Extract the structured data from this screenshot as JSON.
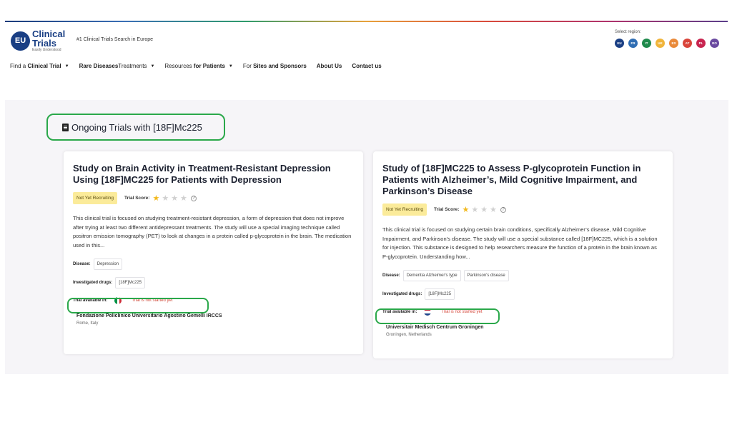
{
  "header": {
    "logo": {
      "badge": "EU",
      "line1": "Clinical",
      "line2": "Trials",
      "line3": "Easily Understood"
    },
    "tagline": "#1 Clinical Trials Search in Europe",
    "region_label": "Select region:",
    "regions": [
      {
        "code": "EU",
        "color": "#1a3f84"
      },
      {
        "code": "FR",
        "color": "#2f6db3"
      },
      {
        "code": "IT",
        "color": "#1f8a4c"
      },
      {
        "code": "UK",
        "color": "#f0b43a"
      },
      {
        "code": "ES",
        "color": "#e98a3a"
      },
      {
        "code": "AT",
        "color": "#d9443a"
      },
      {
        "code": "PL",
        "color": "#c8244f"
      },
      {
        "code": "RO",
        "color": "#6a4aa0"
      }
    ]
  },
  "nav": {
    "find_prefix": "Find a ",
    "find_bold": "Clinical Trial",
    "rare_bold": "Rare Diseases",
    "rare_suffix": " Treatments",
    "resources_prefix": "Resources ",
    "resources_bold": "for Patients",
    "sites_prefix": "For ",
    "sites_bold": "Sites and Sponsors",
    "about": "About Us",
    "contact": "Contact us"
  },
  "section": {
    "title": "Ongoing Trials with [18F]Mc225"
  },
  "trials": [
    {
      "title": "Study on Brain Activity in Treatment-Resistant Depression Using [18F]MC225 for Patients with Depression",
      "status": "Not Yet Recruiting",
      "score_label": "Trial Score:",
      "rating": 1,
      "description": "This clinical trial is focused on studying treatment-resistant depression, a form of depression that does not improve after trying at least two different antidepressant treatments. The study will use a special imaging technique called positron emission tomography (PET) to look at changes in a protein called p-glycoprotein in the brain. The medication used in this...",
      "disease_label": "Disease:",
      "diseases": [
        "Depression"
      ],
      "drugs_label": "Investigated drugs:",
      "drugs": [
        "[18F]Mc225"
      ],
      "available_label": "Trial available in:",
      "country_flag": "italy",
      "availability_status": "Trial is not started yet",
      "site_name": "Fondazione Policlinico Universitario Agostino Gemelli IRCCS",
      "site_location": "Rome, Italy"
    },
    {
      "title": "Study of [18F]MC225 to Assess P-glycoprotein Function in Patients with Alzheimer’s, Mild Cognitive Impairment, and Parkinson’s Disease",
      "status": "Not Yet Recruiting",
      "score_label": "Trial Score:",
      "rating": 1,
      "description": "This clinical trial is focused on studying certain brain conditions, specifically Alzheimer’s disease, Mild Cognitive Impairment, and Parkinson’s disease. The study will use a special substance called [18F]MC225, which is a solution for injection. This substance is designed to help researchers measure the function of a protein in the brain known as P-glycoprotein. Understanding how...",
      "disease_label": "Disease:",
      "diseases": [
        "Dementia Alzheimer's type",
        "Parkinson's disease"
      ],
      "drugs_label": "Investigated drugs:",
      "drugs": [
        "[18F]Mc225"
      ],
      "available_label": "Trial available in:",
      "country_flag": "netherlands",
      "availability_status": "Trial is not started yet",
      "site_name": "Universitair Medisch Centrum Groningen",
      "site_location": "Groningen, Netherlands"
    }
  ]
}
